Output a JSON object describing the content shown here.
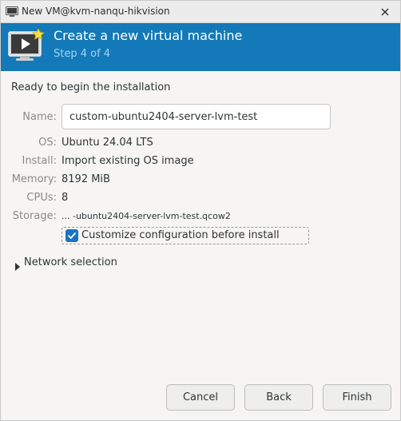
{
  "window": {
    "title": "New VM@kvm-nanqu-hikvision",
    "close_icon": "close-icon"
  },
  "banner": {
    "heading": "Create a new virtual machine",
    "step": "Step 4 of 4",
    "icon": "vm-monitor-icon",
    "color": "#1479b8"
  },
  "summary": {
    "ready_text": "Ready to begin the installation",
    "name_label": "Name:",
    "name_value": "custom-ubuntu2404-server-lvm-test",
    "os_label": "OS:",
    "os_value": "Ubuntu 24.04 LTS",
    "install_label": "Install:",
    "install_value": "Import existing OS image",
    "memory_label": "Memory:",
    "memory_value": "8192 MiB",
    "cpus_label": "CPUs:",
    "cpus_value": "8",
    "storage_label": "Storage:",
    "storage_value": "... -ubuntu2404-server-lvm-test.qcow2"
  },
  "customize": {
    "label": "Customize configuration before install",
    "checked": true,
    "accent": "#1a73c4"
  },
  "network": {
    "label": "Network selection",
    "expanded": false
  },
  "buttons": {
    "cancel": "Cancel",
    "back": "Back",
    "finish": "Finish"
  }
}
